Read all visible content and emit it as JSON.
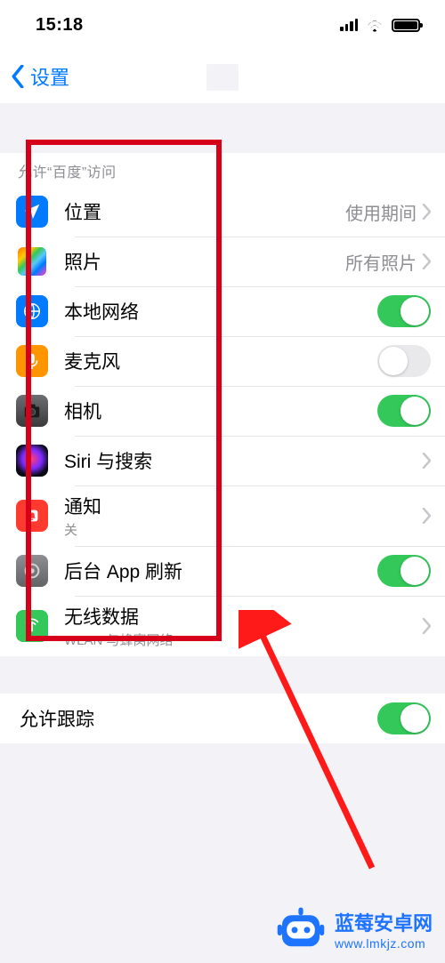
{
  "status": {
    "time": "15:18"
  },
  "nav": {
    "back_label": "设置"
  },
  "section1": {
    "header": "允许“百度”访问",
    "rows": {
      "location": {
        "title": "位置",
        "detail": "使用期间"
      },
      "photos": {
        "title": "照片",
        "detail": "所有照片"
      },
      "local_net": {
        "title": "本地网络",
        "toggle": true
      },
      "microphone": {
        "title": "麦克风",
        "toggle": false
      },
      "camera": {
        "title": "相机",
        "toggle": true
      },
      "siri": {
        "title": "Siri 与搜索"
      },
      "notif": {
        "title": "通知",
        "sub": "关"
      },
      "bgrefresh": {
        "title": "后台 App 刷新",
        "toggle": true
      },
      "wireless": {
        "title": "无线数据",
        "sub": "WLAN 与蜂窝网络"
      }
    }
  },
  "section2": {
    "tracking": {
      "title": "允许跟踪",
      "toggle": true
    }
  },
  "watermark": {
    "name": "蓝莓安卓网",
    "url": "www.lmkjz.com"
  }
}
